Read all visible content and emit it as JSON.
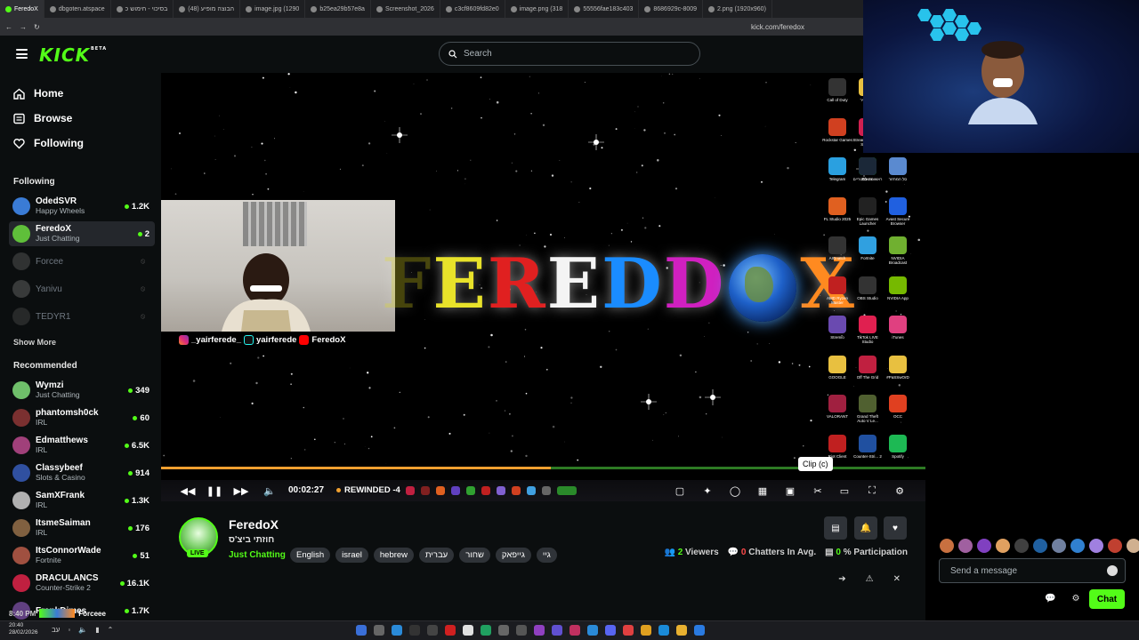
{
  "browser": {
    "tabs": [
      "FeredoX",
      "dbgoten.atspace",
      "בסיכוי - חימוש כ",
      "הבוצה מופיע (48)",
      "image.jpg (1290",
      "b25ea29b57e8a",
      "Screenshot_2026",
      "c3cf8609fd82e0",
      "image.png (318",
      "55556fae183c403",
      "8686929c-8009",
      "2.png (1920x960)"
    ],
    "url": "kick.com/feredox"
  },
  "header": {
    "logo": "KICK",
    "logo_badge": "BETA",
    "search_placeholder": "Search"
  },
  "sidebar": {
    "nav": [
      {
        "label": "Home",
        "icon": "home-icon"
      },
      {
        "label": "Browse",
        "icon": "browse-icon"
      },
      {
        "label": "Following",
        "icon": "heart-icon"
      }
    ],
    "following_title": "Following",
    "following": [
      {
        "name": "OdedSVR",
        "category": "Happy Wheels",
        "viewers": "1.2K",
        "color": "#3a7bd5",
        "live": true
      },
      {
        "name": "FeredoX",
        "category": "Just Chatting",
        "viewers": "2",
        "color": "#5fbf3a",
        "live": true,
        "selected": true
      },
      {
        "name": "Forcee",
        "category": "",
        "viewers": "",
        "color": "#555",
        "live": false
      },
      {
        "name": "Yanivu",
        "category": "",
        "viewers": "",
        "color": "#666",
        "live": false
      },
      {
        "name": "TEDYR1",
        "category": "",
        "viewers": "",
        "color": "#444",
        "live": false
      }
    ],
    "show_more": "Show More",
    "recommended_title": "Recommended",
    "recommended": [
      {
        "name": "Wymzi",
        "category": "Just Chatting",
        "viewers": "349",
        "color": "#6fbf6a"
      },
      {
        "name": "phantomsh0ck",
        "category": "IRL",
        "viewers": "60",
        "color": "#7a3030"
      },
      {
        "name": "Edmatthews",
        "category": "IRL",
        "viewers": "6.5K",
        "color": "#a0407a"
      },
      {
        "name": "Classybeef",
        "category": "Slots & Casino",
        "viewers": "914",
        "color": "#3050a0"
      },
      {
        "name": "SamXFrank",
        "category": "IRL",
        "viewers": "1.3K",
        "color": "#b0b0b0"
      },
      {
        "name": "ItsmeSaiman",
        "category": "IRL",
        "viewers": "176",
        "color": "#806040"
      },
      {
        "name": "ItsConnorWade",
        "category": "Fortnite",
        "viewers": "51",
        "color": "#a05040"
      },
      {
        "name": "DRACULANCS",
        "category": "Counter-Strike 2",
        "viewers": "16.1K",
        "color": "#c02040"
      },
      {
        "name": "FrankDimes",
        "category": "",
        "viewers": "1.7K",
        "color": "#604080"
      }
    ]
  },
  "video": {
    "socials": [
      "_yairferede_",
      "yairferede",
      "FeredoX"
    ],
    "overlay_letters": [
      "F",
      "E",
      "R",
      "E",
      "D",
      "O",
      "X"
    ],
    "time": "00:02:27",
    "rewinded": "REWINDED -4",
    "tooltip": "Clip (c)",
    "progress_played": 0.51,
    "desktop_icons": [
      "לבה ותיר",
      "Call of Duty",
      "StreamElements SE.Live",
      "Rockstar Games",
      "ראשונות לסטריים",
      "Telegram",
      "Steam",
      "סל המחזור",
      "FL Studio 2025",
      "Epic Games Launcher",
      "Avast Secure Browser",
      "AIGnatch",
      "Fortnite",
      "NVIDIA Broadcast",
      "AMD Ryzen Master",
      "OBS Studio",
      "NVIDIA App",
      "Stremio",
      "TikTok LIVE Studio",
      "iTunes",
      "GOOGLE",
      "Off The Grid",
      "#PaSSwOrD",
      "VALORANT",
      "Grand Theft Auto V Le...",
      "OCC",
      "Riot Client",
      "Counter-Stri... 2",
      "Spotify"
    ]
  },
  "channel": {
    "name": "FeredoX",
    "live_label": "LIVE",
    "title": "חוזתי ביצ'ס",
    "category": "Just Chatting",
    "tags": [
      "English",
      "israel",
      "hebrew",
      "עברית",
      "שחור",
      "גייפאק",
      "גיי"
    ],
    "viewers": "2",
    "viewers_label": "Viewers",
    "chatters": "0",
    "chatters_label": "Chatters In Avg.",
    "participation": "0",
    "participation_label": "% Participation"
  },
  "chat": {
    "placeholder": "Send a message",
    "chat_button": "Chat"
  },
  "pip": {
    "time": "8:40 PM",
    "name": "Forceee"
  },
  "taskbar": {
    "clock_time": "20:40",
    "clock_date": "28/02/2026",
    "lang": "עב"
  }
}
